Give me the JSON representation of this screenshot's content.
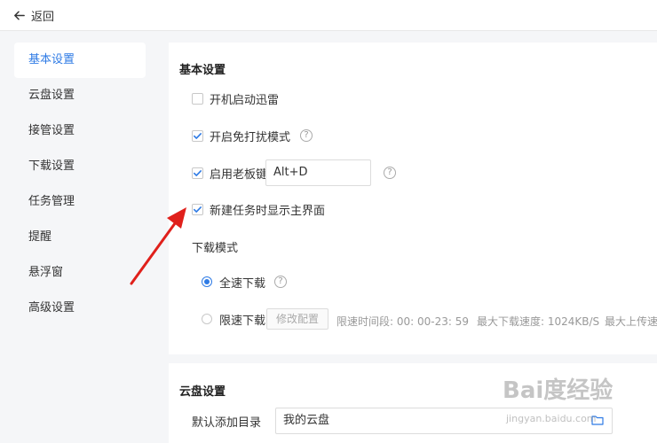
{
  "header": {
    "back_label": "返回"
  },
  "sidebar": {
    "items": [
      {
        "label": "基本设置"
      },
      {
        "label": "云盘设置"
      },
      {
        "label": "接管设置"
      },
      {
        "label": "下载设置"
      },
      {
        "label": "任务管理"
      },
      {
        "label": "提醒"
      },
      {
        "label": "悬浮窗"
      },
      {
        "label": "高级设置"
      }
    ]
  },
  "basic": {
    "title": "基本设置",
    "autostart": {
      "label": "开机启动迅雷",
      "checked": false
    },
    "dnd": {
      "label": "开启免打扰模式",
      "checked": true
    },
    "bosskey": {
      "label": "启用老板键",
      "checked": true,
      "value": "Alt+D"
    },
    "show_main": {
      "label": "新建任务时显示主界面",
      "checked": true
    },
    "download_mode": {
      "title": "下载模式",
      "full_speed": "全速下载",
      "limited": "限速下载",
      "modify_button": "修改配置",
      "period_text": "限速时间段:  00: 00-23: 59",
      "max_down_text": "最大下载速度: 1024KB/S",
      "max_up_text": "最大上传速"
    },
    "help_glyph": "?"
  },
  "cloud": {
    "title": "云盘设置",
    "default_dir_label": "默认添加目录",
    "default_dir_value": "我的云盘"
  },
  "watermark": {
    "logo": "Bai度经验",
    "url": "jingyan.baidu.com"
  },
  "colors": {
    "accent": "#2f7be5",
    "arrow": "#e0201b"
  },
  "icons": {
    "back": "arrow-left-icon",
    "check": "check-icon",
    "help": "question-circle-icon",
    "folder": "folder-icon"
  }
}
